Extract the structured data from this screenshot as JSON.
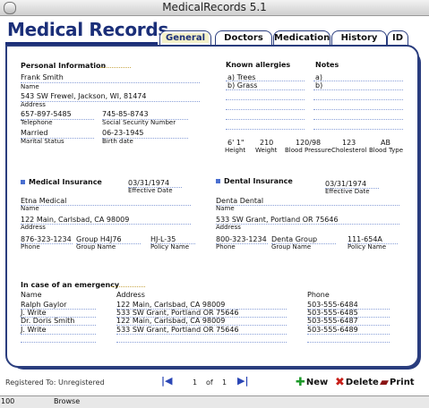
{
  "window": {
    "title": "MedicalRecords 5.1"
  },
  "header": {
    "app_title": "Medical Records"
  },
  "tabs": [
    "General",
    "Doctors",
    "Medication",
    "History",
    "ID"
  ],
  "personal": {
    "section": "Personal Information",
    "name": "Frank Smith",
    "name_label": "Name",
    "address": "543 SW Frewel, Jackson, WI, 81474",
    "address_label": "Address",
    "telephone": "657-897-5485",
    "telephone_label": "Telephone",
    "ssn": "745-85-8743",
    "ssn_label": "Social Security Number",
    "marital": "Married",
    "marital_label": "Marital Status",
    "birth": "06-23-1945",
    "birth_label": "Birth date"
  },
  "allergies": {
    "label": "Known allergies",
    "items": [
      "a) Trees",
      "b) Grass"
    ]
  },
  "notes": {
    "label": "Notes",
    "items": [
      "a)",
      "b)"
    ]
  },
  "vitals": {
    "height": "6' 1\"",
    "height_label": "Height",
    "weight": "210",
    "weight_label": "Weight",
    "bp": "120/98",
    "bp_label": "Blood Pressure",
    "chol": "123",
    "chol_label": "Cholesterol",
    "btype": "AB",
    "btype_label": "Blood Type"
  },
  "medical_ins": {
    "section": "Medical Insurance",
    "date": "03/31/1974",
    "date_label": "Effective Date",
    "name": "Etna Medical",
    "name_label": "Name",
    "address": "122 Main, Carlsbad, CA 98009",
    "address_label": "Address",
    "phone": "876-323-1234",
    "phone_label": "Phone",
    "group": "Group H4J76",
    "group_label": "Group Name",
    "policy": "HJ-L-35",
    "policy_label": "Policy Name"
  },
  "dental_ins": {
    "section": "Dental Insurance",
    "date": "03/31/1974",
    "date_label": "Effective Date",
    "name": "Denta Dental",
    "name_label": "Name",
    "address": "533 SW Grant, Portland OR 75646",
    "address_label": "Address",
    "phone": "800-323-1234",
    "phone_label": "Phone",
    "group": "Denta Group",
    "group_label": "Group Name",
    "policy": "111-654A",
    "policy_label": "Policy Name"
  },
  "emergency": {
    "section": "In case of an emergency",
    "name_col": "Name",
    "address_col": "Address",
    "phone_col": "Phone",
    "rows": [
      {
        "name": "Ralph Gaylor",
        "address": "122 Main, Carlsbad, CA 98009",
        "phone": "503-555-6484"
      },
      {
        "name": "J. Write",
        "address": "533 SW Grant, Portland OR 75646",
        "phone": "503-555-6485"
      },
      {
        "name": "Dr. Doris Smith",
        "address": "122 Main, Carlsbad, CA 98009",
        "phone": "503-555-6487"
      },
      {
        "name": "J. Write",
        "address": "533 SW Grant, Portland OR 75646",
        "phone": "503-555-6489"
      }
    ]
  },
  "footer": {
    "registered": "Registered To: Unregistered",
    "page": "1",
    "of": "of",
    "total": "1",
    "new": "New",
    "delete": "Delete",
    "print": "Print"
  },
  "status": {
    "zoom": "100",
    "mode": "Browse"
  }
}
